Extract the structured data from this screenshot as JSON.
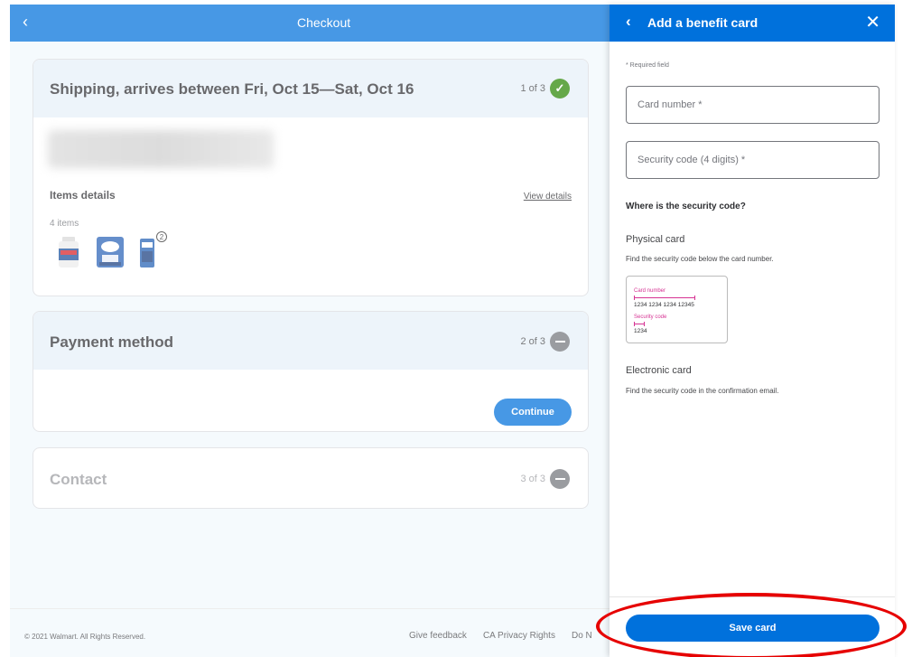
{
  "header": {
    "back_icon": "‹",
    "title": "Checkout"
  },
  "shipping": {
    "title": "Shipping, arrives between Fri, Oct 15—Sat, Oct 16",
    "step": "1 of 3",
    "status_icon": "check-circle-icon",
    "items_label": "Items details",
    "view_details": "View details",
    "item_count": "4 items",
    "thumb_qty_badge": "2"
  },
  "payment": {
    "title": "Payment method",
    "step": "2 of 3",
    "continue_label": "Continue"
  },
  "contact": {
    "title": "Contact",
    "step": "3 of 3"
  },
  "footer": {
    "copyright": "© 2021 Walmart. All Rights Reserved.",
    "links": [
      "Give feedback",
      "CA Privacy Rights",
      "Do N"
    ]
  },
  "panel": {
    "back_icon": "‹",
    "title": "Add a benefit card",
    "close_icon": "✕",
    "required_note": "* Required field",
    "card_number_placeholder": "Card number *",
    "security_code_placeholder": "Security code (4 digits) *",
    "where_heading": "Where is the security code?",
    "physical_title": "Physical card",
    "physical_desc": "Find the security code below the card number.",
    "sample": {
      "card_number_label": "Card number",
      "card_number_value": "1234 1234 1234 12345",
      "security_code_label": "Security code",
      "security_code_value": "1234"
    },
    "electronic_title": "Electronic card",
    "electronic_desc": "Find the security code in the confirmation email.",
    "save_label": "Save card"
  },
  "colors": {
    "brand_blue": "#0071dc",
    "success_green": "#2a8703",
    "annotation_red": "#e60000",
    "sample_pink": "#d63393"
  }
}
